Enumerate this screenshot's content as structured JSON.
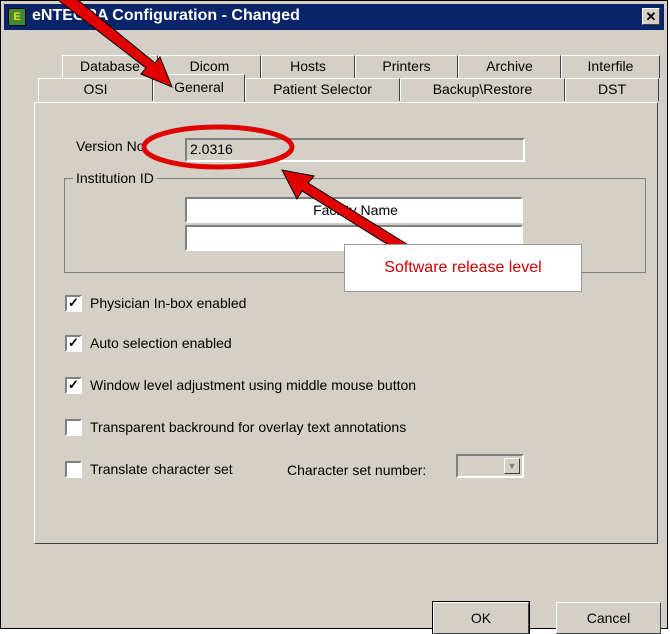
{
  "window": {
    "title": "eNTEGRA Configuration - Changed",
    "app_icon_glyph": "E",
    "close_glyph": "✕"
  },
  "tabs_back_row": [
    "Database",
    "Dicom",
    "Hosts",
    "Printers",
    "Archive",
    "Interfile"
  ],
  "tabs_front_row": [
    "OSI",
    "General",
    "Patient Selector",
    "Backup\\Restore",
    "DST"
  ],
  "active_tab": "General",
  "general": {
    "version_label": "Version No",
    "version_value": "2.0316",
    "institution_group_label": "Institution ID",
    "institution_name_value": "Facility Name",
    "institution_second_value": "",
    "checkboxes": [
      {
        "label": "Physician In-box enabled",
        "checked": true
      },
      {
        "label": "Auto selection enabled",
        "checked": true
      },
      {
        "label": "Window level adjustment using middle mouse button",
        "checked": true
      },
      {
        "label": "Transparent backround for overlay text annotations",
        "checked": false
      },
      {
        "label": "Translate character set",
        "checked": false
      }
    ],
    "charset_label": "Character set number:",
    "charset_value": ""
  },
  "buttons": {
    "ok": "OK",
    "cancel": "Cancel"
  },
  "annotation": {
    "callout_text": "Software release level",
    "color": "#e00000"
  },
  "colors": {
    "titlebar": "#0a246a",
    "face": "#d4d0c8"
  }
}
